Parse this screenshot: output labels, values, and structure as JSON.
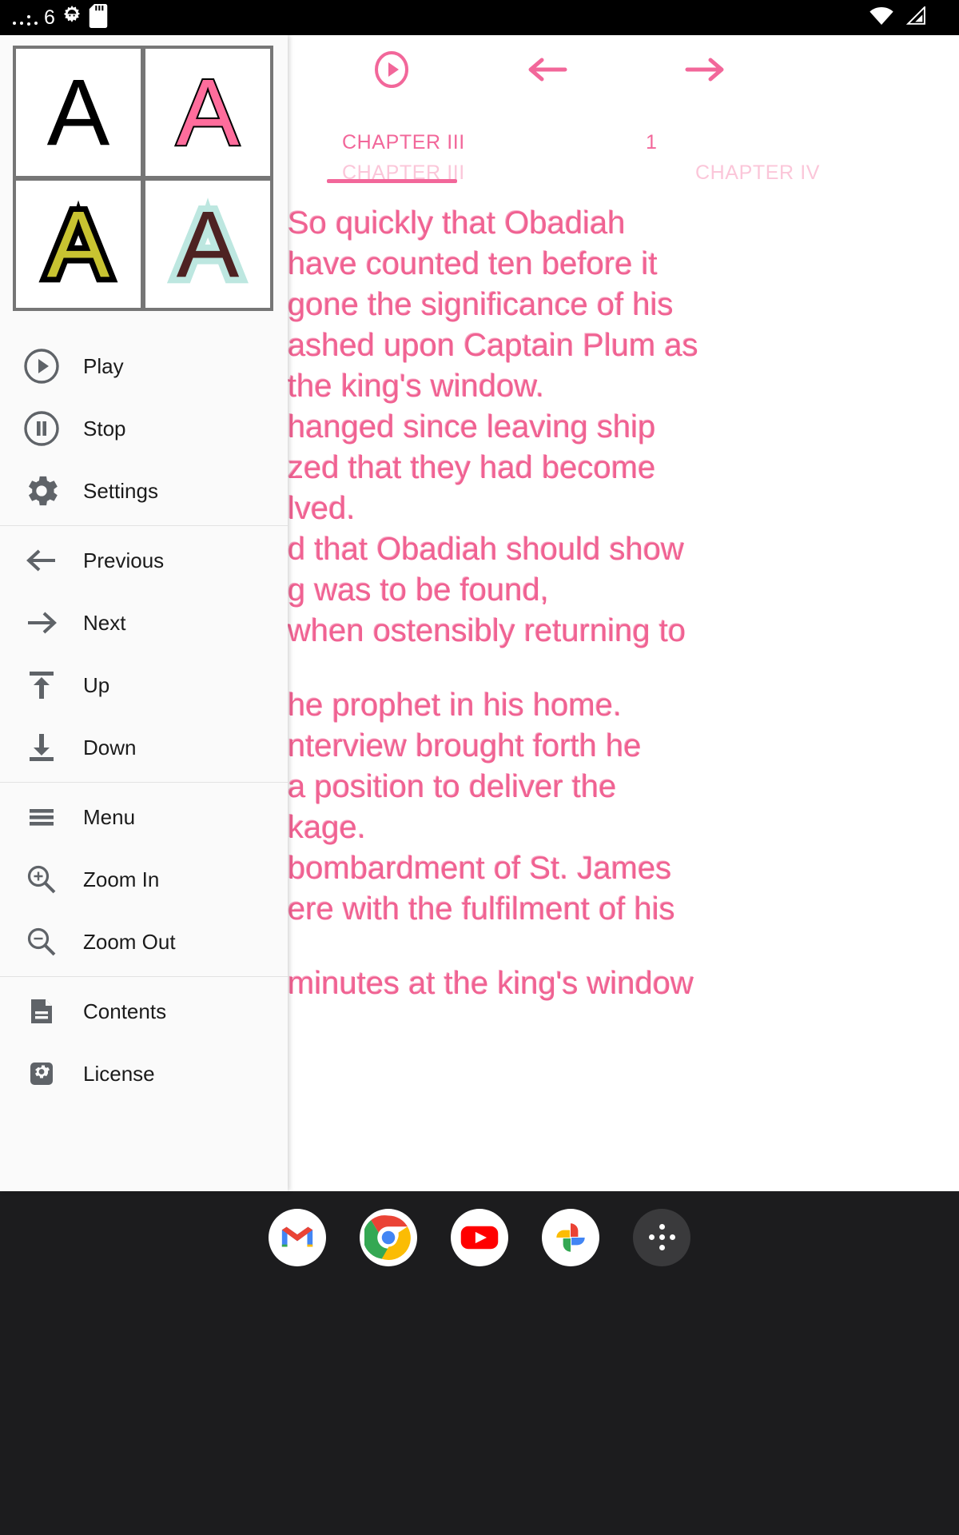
{
  "statusbar": {
    "left_number": "6",
    "icons": [
      "dot-icon",
      "dot-icon",
      "colon-icon",
      "dot-icon",
      "android-gear-icon",
      "sd-card-icon"
    ],
    "right_icons": [
      "wifi-icon",
      "cell-signal-icon"
    ]
  },
  "drawer": {
    "preview": {
      "title": "font-style-preview",
      "cells": [
        {
          "name": "style-plain",
          "glyph": "A",
          "fill": "#000000",
          "outline": ""
        },
        {
          "name": "style-pink-outline",
          "glyph": "A",
          "fill": "#ff6d9c",
          "outline": "#000000"
        },
        {
          "name": "style-yellow-on-black",
          "glyph": "A",
          "fill": "#c8c331",
          "outline": "#000000"
        },
        {
          "name": "style-maroon-on-mint",
          "glyph": "A",
          "fill": "#4e2222",
          "outline": "#bde7e0"
        }
      ]
    },
    "groups": [
      {
        "items": [
          {
            "label": "Play",
            "icon": "play-circle-icon"
          },
          {
            "label": "Stop",
            "icon": "pause-circle-icon"
          },
          {
            "label": "Settings",
            "icon": "gear-icon"
          }
        ]
      },
      {
        "items": [
          {
            "label": "Previous",
            "icon": "arrow-left-icon"
          },
          {
            "label": "Next",
            "icon": "arrow-right-icon"
          },
          {
            "label": "Up",
            "icon": "arrow-up-to-bar-icon"
          },
          {
            "label": "Down",
            "icon": "arrow-down-to-bar-icon"
          }
        ]
      },
      {
        "items": [
          {
            "label": "Menu",
            "icon": "hamburger-menu-icon"
          },
          {
            "label": "Zoom In",
            "icon": "magnifier-plus-icon"
          },
          {
            "label": "Zoom Out",
            "icon": "magnifier-minus-icon"
          }
        ]
      },
      {
        "items": [
          {
            "label": "Contents",
            "icon": "document-icon"
          },
          {
            "label": "License",
            "icon": "license-gear-icon"
          }
        ]
      }
    ]
  },
  "reader": {
    "toolbar": {
      "play_label": "play-button",
      "prev_label": "previous-button",
      "next_label": "next-button"
    },
    "tabs": {
      "current_label": "CHAPTER III",
      "active_label": "CHAPTER III",
      "next_label": "CHAPTER IV",
      "page_number": "1"
    },
    "accent_color": "#f2679a",
    "body_lines": [
      "So quickly that Obadiah",
      "have counted ten before it",
      "gone the significance of his",
      "ashed upon Captain Plum as",
      "the king's window.",
      "hanged since leaving ship",
      "zed that they had become",
      "lved.",
      "d that Obadiah should show",
      "g was to be found,",
      "when ostensibly returning to",
      "",
      "he prophet in his home.",
      "nterview brought forth he",
      "a position to deliver the",
      "kage.",
      "bombardment of St. James",
      "ere with the fulfilment of his",
      "",
      "minutes at the king's window"
    ]
  },
  "dock": {
    "apps": [
      {
        "name": "gmail-icon",
        "label": "Gmail"
      },
      {
        "name": "chrome-icon",
        "label": "Chrome"
      },
      {
        "name": "youtube-icon",
        "label": "YouTube"
      },
      {
        "name": "photos-icon",
        "label": "Photos"
      },
      {
        "name": "app-drawer-icon",
        "label": "All apps"
      }
    ]
  }
}
